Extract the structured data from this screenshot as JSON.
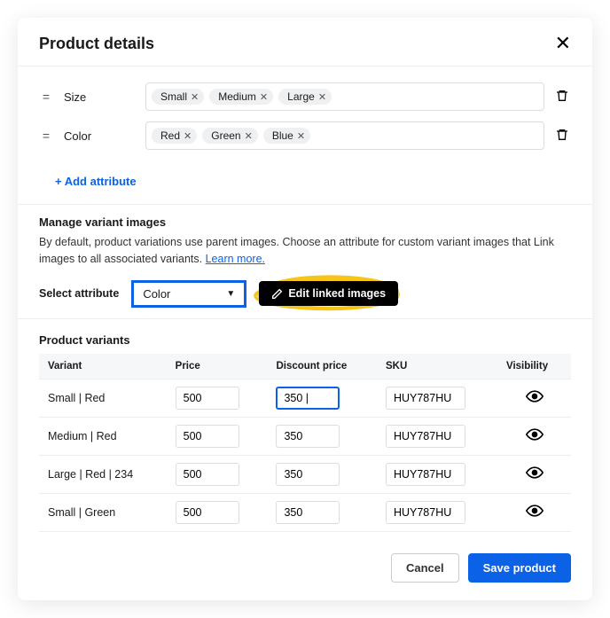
{
  "dialog": {
    "title": "Product details"
  },
  "attributes": [
    {
      "name": "Size",
      "values": [
        "Small",
        "Medium",
        "Large"
      ]
    },
    {
      "name": "Color",
      "values": [
        "Red",
        "Green",
        "Blue"
      ]
    }
  ],
  "add_attribute_label": "+ Add attribute",
  "manage_variants": {
    "title": "Manage variant images",
    "description": "By default, product variations use parent images. Choose an attribute for custom variant images that Link images to all associated variants.",
    "learn_more": "Learn more.",
    "select_label": "Select attribute",
    "selected_attribute": "Color",
    "edit_button": "Edit linked images"
  },
  "variants": {
    "title": "Product variants",
    "columns": {
      "variant": "Variant",
      "price": "Price",
      "discount": "Discount price",
      "sku": "SKU",
      "visibility": "Visibility"
    },
    "rows": [
      {
        "variant": "Small | Red",
        "price": "500",
        "discount": "350 |",
        "discount_focused": true,
        "sku": "HUY787HU"
      },
      {
        "variant": "Medium | Red",
        "price": "500",
        "discount": "350",
        "discount_focused": false,
        "sku": "HUY787HU"
      },
      {
        "variant": "Large | Red | 234",
        "price": "500",
        "discount": "350",
        "discount_focused": false,
        "sku": "HUY787HU"
      },
      {
        "variant": "Small | Green",
        "price": "500",
        "discount": "350",
        "discount_focused": false,
        "sku": "HUY787HU"
      }
    ]
  },
  "footer": {
    "cancel": "Cancel",
    "save": "Save product"
  },
  "colors": {
    "accent": "#0b62e6",
    "highlight": "#f5c518"
  }
}
